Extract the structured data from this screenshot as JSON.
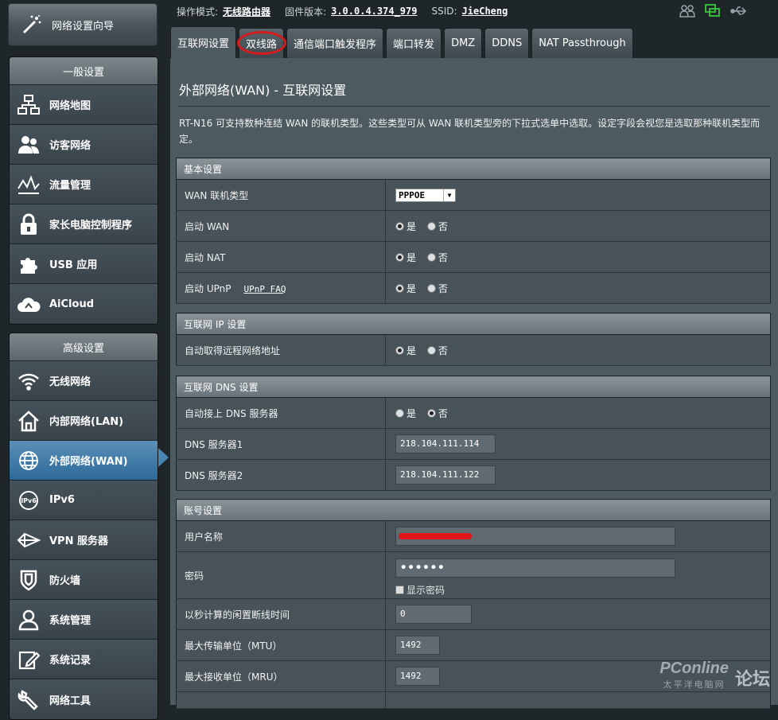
{
  "sidebar": {
    "wizard_label": "网络设置向导",
    "general_title": "一般设置",
    "general_items": [
      {
        "label": "网络地图",
        "icon": "network-map-icon"
      },
      {
        "label": "访客网络",
        "icon": "guest-network-icon"
      },
      {
        "label": "流量管理",
        "icon": "traffic-manager-icon"
      },
      {
        "label": "家长电脑控制程序",
        "icon": "parental-lock-icon"
      },
      {
        "label": "USB 应用",
        "icon": "usb-puzzle-icon"
      },
      {
        "label": "AiCloud",
        "icon": "cloud-icon"
      }
    ],
    "advanced_title": "高级设置",
    "advanced_items": [
      {
        "label": "无线网络",
        "icon": "wifi-icon"
      },
      {
        "label": "内部网络(LAN)",
        "icon": "home-icon"
      },
      {
        "label": "外部网络(WAN)",
        "icon": "globe-icon",
        "active": true
      },
      {
        "label": "IPv6",
        "icon": "ipv6-icon"
      },
      {
        "label": "VPN 服务器",
        "icon": "vpn-icon"
      },
      {
        "label": "防火墙",
        "icon": "shield-icon"
      },
      {
        "label": "系统管理",
        "icon": "admin-user-icon"
      },
      {
        "label": "系统记录",
        "icon": "log-icon"
      },
      {
        "label": "网络工具",
        "icon": "tools-icon"
      }
    ]
  },
  "status": {
    "mode_label": "操作模式:",
    "mode_value": "无线路由器",
    "firmware_label": "固件版本:",
    "firmware_value": "3.0.0.4.374_979",
    "ssid_label": "SSID:",
    "ssid_value": "JieCheng"
  },
  "tabs": [
    {
      "label": "互联网设置",
      "active": true
    },
    {
      "label": "双线路",
      "circled": true
    },
    {
      "label": "通信端口触发程序"
    },
    {
      "label": "端口转发"
    },
    {
      "label": "DMZ"
    },
    {
      "label": "DDNS"
    },
    {
      "label": "NAT Passthrough"
    }
  ],
  "page": {
    "title": "外部网络(WAN) - 互联网设置",
    "description": "RT-N16 可支持数种连结 WAN 的联机类型。这些类型可从 WAN 联机类型旁的下拉式选单中选取。设定字段会视您是选取那种联机类型而定。"
  },
  "basic": {
    "title": "基本设置",
    "wan_type_label": "WAN 联机类型",
    "wan_type_value": "PPPOE",
    "enable_wan_label": "启动 WAN",
    "enable_nat_label": "启动 NAT",
    "enable_upnp_label": "启动 UPnP",
    "upnp_faq": "UPnP FAQ",
    "yes": "是",
    "no": "否"
  },
  "ip": {
    "title": "互联网 IP 设置",
    "auto_ip_label": "自动取得远程网络地址"
  },
  "dns": {
    "title": "互联网 DNS 设置",
    "auto_dns_label": "自动接上 DNS 服务器",
    "dns1_label": "DNS 服务器1",
    "dns1_value": "218.104.111.114",
    "dns2_label": "DNS 服务器2",
    "dns2_value": "218.104.111.122"
  },
  "account": {
    "title": "账号设置",
    "username_label": "用户名称",
    "password_label": "密码",
    "password_value": "••••••",
    "show_password_label": "显示密码",
    "idle_label": "以秒计算的闲置断线时间",
    "idle_value": "0",
    "mtu_label": "最大传输单位（MTU）",
    "mtu_value": "1492",
    "mru_label": "最大接收单位（MRU）",
    "mru_value": "1492"
  },
  "watermark": {
    "logo": "PConline",
    "sub": "太平洋电脑网",
    "forum": "论坛"
  }
}
